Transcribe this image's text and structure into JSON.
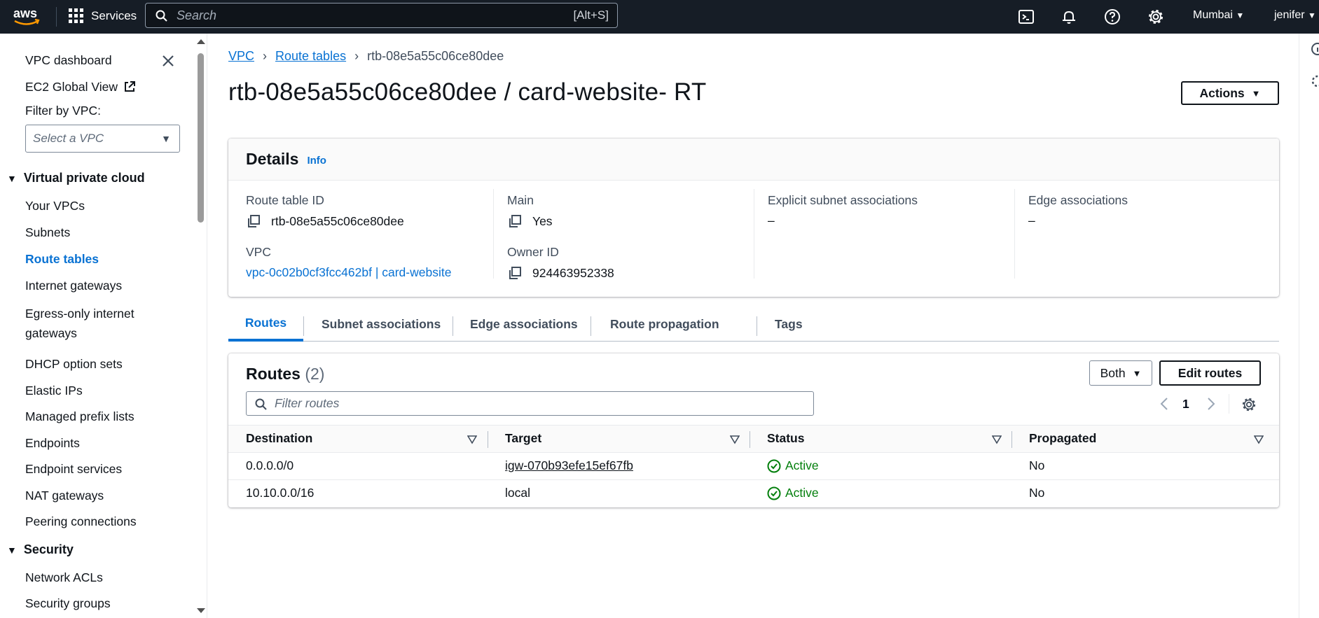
{
  "topbar": {
    "brand": "aws",
    "services_label": "Services",
    "search_placeholder": "Search",
    "search_shortcut": "[Alt+S]",
    "region": "Mumbai",
    "user": "jenifer"
  },
  "sidebar": {
    "dashboard": "VPC dashboard",
    "ec2_global": "EC2 Global View",
    "filter_label": "Filter by VPC:",
    "filter_placeholder": "Select a VPC",
    "section1": "Virtual private cloud",
    "items": [
      "Your VPCs",
      "Subnets",
      "Route tables",
      "Internet gateways",
      "Egress-only internet gateways",
      "DHCP option sets",
      "Elastic IPs",
      "Managed prefix lists",
      "Endpoints",
      "Endpoint services",
      "NAT gateways",
      "Peering connections"
    ],
    "egress_line1": "Egress-only internet",
    "egress_line2": "gateways",
    "section2": "Security",
    "security_items": [
      "Network ACLs",
      "Security groups"
    ]
  },
  "breadcrumb": {
    "vpc": "VPC",
    "route_tables": "Route tables",
    "current": "rtb-08e5a55c06ce80dee"
  },
  "page": {
    "title": "rtb-08e5a55c06ce80dee / card-website- RT",
    "actions_label": "Actions"
  },
  "details": {
    "title": "Details",
    "info": "Info",
    "route_table_id_label": "Route table ID",
    "route_table_id": "rtb-08e5a55c06ce80dee",
    "vpc_label": "VPC",
    "vpc": "vpc-0c02b0cf3fcc462bf | card-website",
    "main_label": "Main",
    "main": "Yes",
    "owner_label": "Owner ID",
    "owner": "924463952338",
    "explicit_label": "Explicit subnet associations",
    "explicit": "–",
    "edge_label": "Edge associations",
    "edge": "–"
  },
  "tabs": [
    "Routes",
    "Subnet associations",
    "Edge associations",
    "Route propagation",
    "Tags"
  ],
  "routes": {
    "title": "Routes",
    "count": "(2)",
    "both_label": "Both",
    "edit_label": "Edit routes",
    "filter_placeholder": "Filter routes",
    "page": "1",
    "columns": [
      "Destination",
      "Target",
      "Status",
      "Propagated"
    ],
    "rows": [
      {
        "destination": "0.0.0.0/0",
        "target": "igw-070b93efe15ef67fb",
        "status": "Active",
        "propagated": "No"
      },
      {
        "destination": "10.10.0.0/16",
        "target": "local",
        "status": "Active",
        "propagated": "No"
      }
    ]
  },
  "colors": {
    "topbar": "#161d26",
    "link": "#0972d3",
    "success": "#037f0c"
  }
}
